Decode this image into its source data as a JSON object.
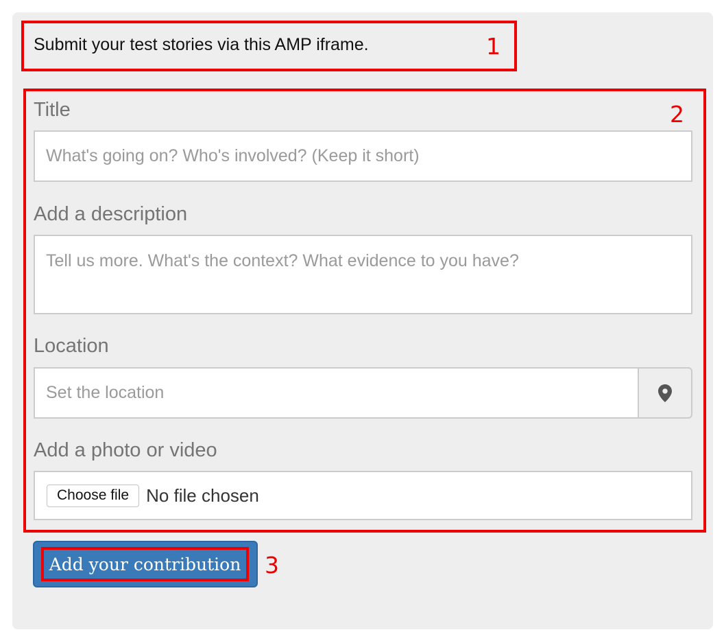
{
  "intro": {
    "text": "Submit your test stories via this AMP iframe."
  },
  "annotations": [
    "1",
    "2",
    "3"
  ],
  "form": {
    "title": {
      "label": "Title",
      "placeholder": "What's going on? Who's involved? (Keep it short)",
      "value": ""
    },
    "description": {
      "label": "Add a description",
      "placeholder": "Tell us more. What's the context? What evidence to you have?",
      "value": ""
    },
    "location": {
      "label": "Location",
      "placeholder": "Set the location",
      "value": "",
      "icon": "map-pin-icon"
    },
    "media": {
      "label": "Add a photo or video",
      "choose_button": "Choose file",
      "status": "No file chosen"
    },
    "submit_label": "Add your contribution"
  },
  "colors": {
    "annotation": "#ee0000",
    "panel_background": "#eeeeee",
    "submit_background": "#3a7ab9",
    "label_text": "#747474",
    "placeholder_text": "#9a9a9a"
  }
}
